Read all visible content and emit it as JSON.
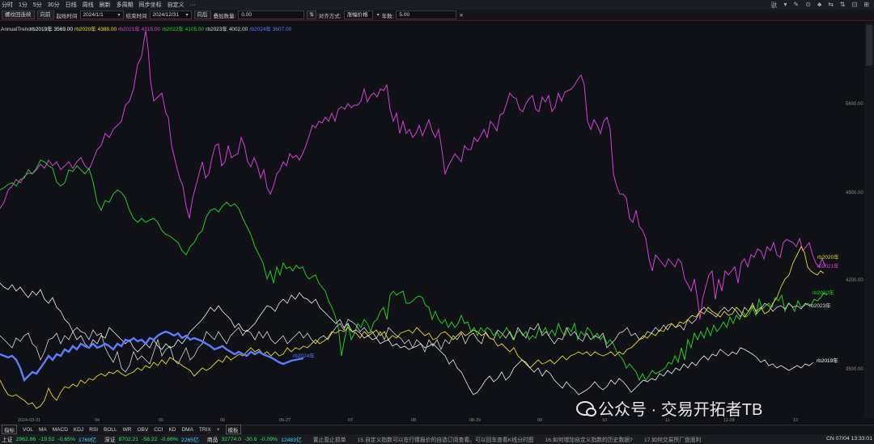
{
  "menubar": {
    "items": [
      "分时",
      "1分",
      "5分",
      "30分",
      "日线",
      "周线",
      "刷新",
      "多周期",
      "同步坐标",
      "自定义",
      "···"
    ],
    "right_icons": [
      "驮",
      "▾",
      "✎",
      "⊙",
      "♣",
      "⇆",
      "⇅",
      "⊡",
      "⊞"
    ]
  },
  "toolbar": {
    "mode_button": "螺纹回连续",
    "forward_button": "向前",
    "start_label": "起始时间",
    "start_value": "2024/1/1",
    "end_label": "结束时间",
    "end_value": "2024/12/31",
    "back_button": "向后",
    "overlay_label": "叠加数量:",
    "overlay_value": "0.00",
    "align_label": "对齐方式:",
    "align_value": "涨幅价格",
    "years_label": "年数:",
    "years_value": "5.00"
  },
  "legend": {
    "prefix": "AnnualTrend",
    "entries": [
      {
        "text": "rb2019年 3569.00",
        "color": "#ffffff"
      },
      {
        "text": "rb2020年 4388.00",
        "color": "#f0e020"
      },
      {
        "text": "rb2021年 4315.00",
        "color": "#e040e0"
      },
      {
        "text": "rb2022年 4105.00",
        "color": "#22dd22"
      },
      {
        "text": "rb2023年 4002.00",
        "color": "#dddddd"
      },
      {
        "text": "rb2024年 3607.00",
        "color": "#5b7dff"
      }
    ]
  },
  "price_axis": {
    "labels": [
      "5600.00",
      "4900.00",
      "4200.00",
      "3500.00"
    ]
  },
  "end_labels": {
    "rb2020": "rb2020年",
    "rb2021": "rb2021年",
    "rb2022": "rb2022年",
    "rb2023": "rb2023年",
    "rb2019": "rb2019年",
    "rb2024": "rb2024年"
  },
  "xaxis": {
    "labels": [
      "2024-03-31",
      "04",
      "05",
      "06",
      "06-27",
      "07",
      "08",
      "08-29",
      "09",
      "10",
      "11",
      "11-28",
      "12"
    ]
  },
  "indicators": {
    "items": [
      "指标",
      "VOL",
      "MA",
      "MACD",
      "KDJ",
      "RSI",
      "BOLL",
      "WR",
      "OBV",
      "CCI",
      "KD",
      "DMA",
      "TRIX",
      "+",
      "模板"
    ]
  },
  "statusbar": {
    "sh_label": "上证",
    "sh_price": "2962.86",
    "sh_change": "-19.52",
    "sh_pct": "-0.65%",
    "sh_vol": "1769亿",
    "sz_label": "深证",
    "sz_price": "8702.21",
    "sz_change": "-58.22",
    "sz_pct": "-0.66%",
    "sz_vol": "2265亿",
    "sp_label": "商品",
    "sp_price": "32774.0",
    "sp_change": "-30.6",
    "sp_pct": "-0.09%",
    "sp_vol": "12483亿",
    "tip1": "置止盈止损单",
    "tip2": "15.自定义指数可以在行情报价的自选订阅查看。可以回车查看K线分时图",
    "tip3": "16.如何增加自定义指数的历史数据?",
    "tip4": "17.如何交易所厂盘面利",
    "clock": "CN 07/04 13:33:01"
  },
  "watermark": {
    "text": "公众号 · 交易开拓者TB"
  },
  "chart_data": {
    "type": "line",
    "y_axis_ticks": [
      5600,
      4900,
      4200,
      3500
    ],
    "x_labels": [
      "2024-03-31",
      "04",
      "05",
      "06",
      "06-27",
      "07",
      "08",
      "08-29",
      "09",
      "10",
      "11",
      "11-28",
      "12"
    ],
    "series": [
      {
        "name": "rb2019年",
        "color": "#ffffff",
        "last": 3569
      },
      {
        "name": "rb2020年",
        "color": "#f0e020",
        "last": 4388
      },
      {
        "name": "rb2021年",
        "color": "#e040e0",
        "last": 4315
      },
      {
        "name": "rb2022年",
        "color": "#22dd22",
        "last": 4105
      },
      {
        "name": "rb2023年",
        "color": "#dddddd",
        "last": 4002
      },
      {
        "name": "rb2024年",
        "color": "#5b7dff",
        "last": 3607
      }
    ]
  }
}
